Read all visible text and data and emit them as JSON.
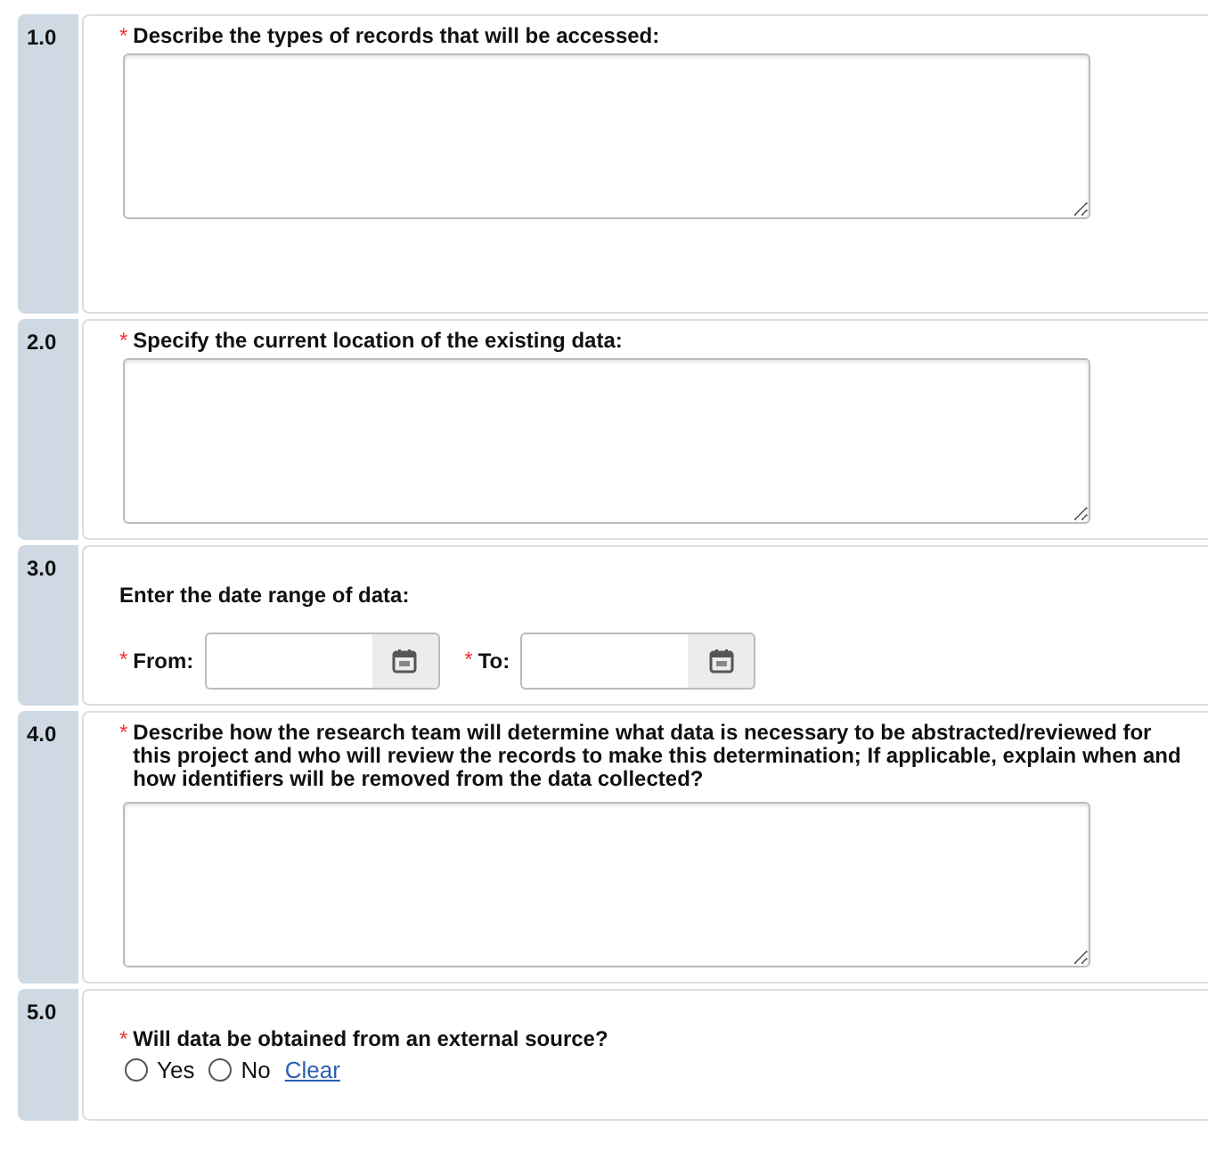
{
  "sections": [
    {
      "number": "1.0",
      "kind": "textarea",
      "required_mark": "*",
      "label": "Describe the types of records that will be accessed:"
    },
    {
      "number": "2.0",
      "kind": "textarea",
      "required_mark": "*",
      "label": "Specify the current location of the existing data:"
    },
    {
      "number": "3.0",
      "kind": "daterange",
      "label": "Enter the date range of data:",
      "fields": [
        {
          "label": "From:",
          "required_mark": "*"
        },
        {
          "label": "To:",
          "required_mark": "*"
        }
      ]
    },
    {
      "number": "4.0",
      "kind": "textarea",
      "required_mark": "*",
      "label": "Describe how the research team will determine what data is necessary to be abstracted/reviewed for this project and who will review the records to make this determination; If applicable, explain when and how identifiers will be removed from the data collected?"
    },
    {
      "number": "5.0",
      "kind": "radio",
      "required_mark": "*",
      "label": "Will data be obtained from an external source?",
      "options": [
        {
          "label": "Yes",
          "selected": false
        },
        {
          "label": "No",
          "selected": false
        }
      ],
      "clear": "Clear"
    }
  ]
}
